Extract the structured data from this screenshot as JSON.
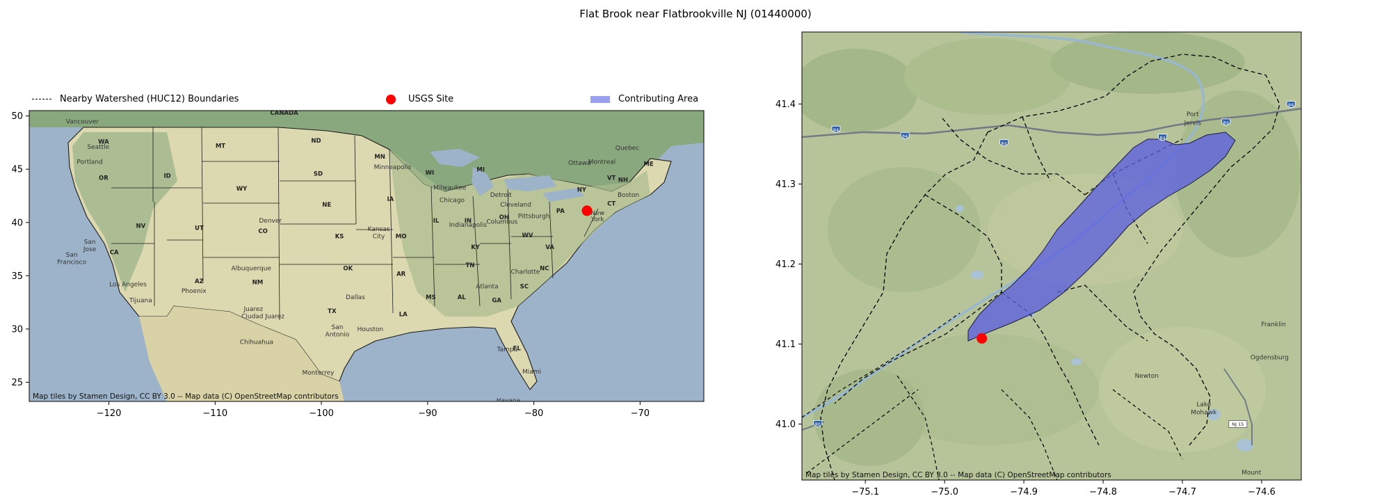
{
  "figure": {
    "title": "Flat Brook near Flatbrookville NJ (01440000)"
  },
  "legend": {
    "items": [
      {
        "key": "huc12",
        "label": "Nearby Watershed (HUC12) Boundaries",
        "style": "dashed-line"
      },
      {
        "key": "site",
        "label": "USGS Site",
        "style": "marker",
        "color": "#ff0000"
      },
      {
        "key": "area",
        "label": "Contributing Area",
        "style": "patch",
        "color": "#9aa0ee"
      }
    ]
  },
  "overview_map": {
    "extent": {
      "lon": [
        -127.5,
        -64.0
      ],
      "lat": [
        23.2,
        50.5
      ]
    },
    "x_ticks": [
      -120,
      -110,
      -100,
      -90,
      -80,
      -70
    ],
    "y_ticks": [
      25,
      30,
      35,
      40,
      45,
      50
    ],
    "site": {
      "lon": -75.0,
      "lat": 41.1
    },
    "credit": "Map tiles by Stamen Design, CC BY 3.0 -- Map data (C) OpenStreetMap contributors",
    "labels": [
      {
        "text": "CANADA",
        "lon": -103.5,
        "lat": 50.1
      },
      {
        "text": "Vancouver",
        "lon": -122.5,
        "lat": 49.3
      },
      {
        "text": "WA",
        "lon": -120.5,
        "lat": 47.4
      },
      {
        "text": "Seattle",
        "lon": -121.0,
        "lat": 46.9
      },
      {
        "text": "Portland",
        "lon": -121.8,
        "lat": 45.5
      },
      {
        "text": "OR",
        "lon": -120.5,
        "lat": 44.0
      },
      {
        "text": "ID",
        "lon": -114.5,
        "lat": 44.2
      },
      {
        "text": "MT",
        "lon": -109.5,
        "lat": 47.0
      },
      {
        "text": "WY",
        "lon": -107.5,
        "lat": 43.0
      },
      {
        "text": "NV",
        "lon": -117.0,
        "lat": 39.5
      },
      {
        "text": "UT",
        "lon": -111.5,
        "lat": 39.3
      },
      {
        "text": "CO",
        "lon": -105.5,
        "lat": 39.0
      },
      {
        "text": "Denver",
        "lon": -104.8,
        "lat": 40.0
      },
      {
        "text": "San",
        "lon": -121.8,
        "lat": 38.0
      },
      {
        "text": "Jose",
        "lon": -121.8,
        "lat": 37.3
      },
      {
        "text": "San",
        "lon": -123.5,
        "lat": 36.8
      },
      {
        "text": "Francisco",
        "lon": -123.5,
        "lat": 36.1
      },
      {
        "text": "CA",
        "lon": -119.5,
        "lat": 37.0
      },
      {
        "text": "Los Angeles",
        "lon": -118.2,
        "lat": 34.0
      },
      {
        "text": "AZ",
        "lon": -111.5,
        "lat": 34.3
      },
      {
        "text": "Phoenix",
        "lon": -112.0,
        "lat": 33.4
      },
      {
        "text": "Tijuana",
        "lon": -117.0,
        "lat": 32.5
      },
      {
        "text": "NM",
        "lon": -106.0,
        "lat": 34.2
      },
      {
        "text": "Albuquerque",
        "lon": -106.6,
        "lat": 35.5
      },
      {
        "text": "Juarez",
        "lon": -106.4,
        "lat": 31.7
      },
      {
        "text": "ND",
        "lon": -100.5,
        "lat": 47.5
      },
      {
        "text": "SD",
        "lon": -100.3,
        "lat": 44.4
      },
      {
        "text": "NE",
        "lon": -99.5,
        "lat": 41.5
      },
      {
        "text": "KS",
        "lon": -98.3,
        "lat": 38.5
      },
      {
        "text": "OK",
        "lon": -97.5,
        "lat": 35.5
      },
      {
        "text": "TX",
        "lon": -99.0,
        "lat": 31.5
      },
      {
        "text": "Dallas",
        "lon": -96.8,
        "lat": 32.8
      },
      {
        "text": "San",
        "lon": -98.5,
        "lat": 30.0
      },
      {
        "text": "Antonio",
        "lon": -98.5,
        "lat": 29.3
      },
      {
        "text": "Houston",
        "lon": -95.4,
        "lat": 29.8
      },
      {
        "text": "Ciudad Juarez",
        "lon": -105.5,
        "lat": 31.0
      },
      {
        "text": "Chihuahua",
        "lon": -106.1,
        "lat": 28.6
      },
      {
        "text": "Monterrey",
        "lon": -100.3,
        "lat": 25.7
      },
      {
        "text": "MN",
        "lon": -94.5,
        "lat": 46.0
      },
      {
        "text": "Minneapolis",
        "lon": -93.3,
        "lat": 45.0
      },
      {
        "text": "IA",
        "lon": -93.5,
        "lat": 42.0
      },
      {
        "text": "MO",
        "lon": -92.5,
        "lat": 38.5
      },
      {
        "text": "Kansas",
        "lon": -94.6,
        "lat": 39.2
      },
      {
        "text": "City",
        "lon": -94.6,
        "lat": 38.5
      },
      {
        "text": "AR",
        "lon": -92.5,
        "lat": 35.0
      },
      {
        "text": "LA",
        "lon": -92.3,
        "lat": 31.2
      },
      {
        "text": "WI",
        "lon": -89.8,
        "lat": 44.5
      },
      {
        "text": "Milwaukee",
        "lon": -87.9,
        "lat": 43.1
      },
      {
        "text": "Chicago",
        "lon": -87.7,
        "lat": 41.9
      },
      {
        "text": "IL",
        "lon": -89.2,
        "lat": 40.0
      },
      {
        "text": "MI",
        "lon": -85.0,
        "lat": 44.8
      },
      {
        "text": "Detroit",
        "lon": -83.1,
        "lat": 42.4
      },
      {
        "text": "IN",
        "lon": -86.2,
        "lat": 40.0
      },
      {
        "text": "Indianapolis",
        "lon": -86.2,
        "lat": 39.6
      },
      {
        "text": "OH",
        "lon": -82.8,
        "lat": 40.3
      },
      {
        "text": "Columbus",
        "lon": -83.0,
        "lat": 39.9
      },
      {
        "text": "Cleveland",
        "lon": -81.7,
        "lat": 41.5
      },
      {
        "text": "KY",
        "lon": -85.5,
        "lat": 37.5
      },
      {
        "text": "TN",
        "lon": -86.0,
        "lat": 35.8
      },
      {
        "text": "MS",
        "lon": -89.7,
        "lat": 32.8
      },
      {
        "text": "AL",
        "lon": -86.8,
        "lat": 32.8
      },
      {
        "text": "GA",
        "lon": -83.5,
        "lat": 32.5
      },
      {
        "text": "Atlanta",
        "lon": -84.4,
        "lat": 33.8
      },
      {
        "text": "FL",
        "lon": -81.6,
        "lat": 28.0
      },
      {
        "text": "Tampa",
        "lon": -82.5,
        "lat": 27.9
      },
      {
        "text": "Miami",
        "lon": -80.2,
        "lat": 25.8
      },
      {
        "text": "Havana",
        "lon": -82.4,
        "lat": 23.1
      },
      {
        "text": "SC",
        "lon": -80.9,
        "lat": 33.8
      },
      {
        "text": "NC",
        "lon": -79.0,
        "lat": 35.5
      },
      {
        "text": "Charlotte",
        "lon": -80.8,
        "lat": 35.2
      },
      {
        "text": "VA",
        "lon": -78.5,
        "lat": 37.5
      },
      {
        "text": "WV",
        "lon": -80.6,
        "lat": 38.6
      },
      {
        "text": "PA",
        "lon": -77.5,
        "lat": 40.9
      },
      {
        "text": "Pittsburgh",
        "lon": -80.0,
        "lat": 40.4
      },
      {
        "text": "NY",
        "lon": -75.5,
        "lat": 42.9
      },
      {
        "text": "New",
        "lon": -74.0,
        "lat": 40.7
      },
      {
        "text": "York",
        "lon": -74.0,
        "lat": 40.1
      },
      {
        "text": "Ottawa",
        "lon": -75.7,
        "lat": 45.4
      },
      {
        "text": "Montreal",
        "lon": -73.6,
        "lat": 45.5
      },
      {
        "text": "Quebec",
        "lon": -71.2,
        "lat": 46.8
      },
      {
        "text": "VT",
        "lon": -72.7,
        "lat": 44.0
      },
      {
        "text": "NH",
        "lon": -71.6,
        "lat": 43.8
      },
      {
        "text": "ME",
        "lon": -69.2,
        "lat": 45.3
      },
      {
        "text": "Boston",
        "lon": -71.1,
        "lat": 42.4
      },
      {
        "text": "CT",
        "lon": -72.7,
        "lat": 41.6
      }
    ]
  },
  "detail_map": {
    "extent": {
      "lon": [
        -75.18,
        -74.55
      ],
      "lat": [
        40.93,
        41.49
      ]
    },
    "x_ticks": [
      -75.1,
      -75.0,
      -74.9,
      -74.8,
      -74.7,
      -74.6
    ],
    "y_ticks": [
      41.0,
      41.1,
      41.2,
      41.3,
      41.4
    ],
    "site": {
      "lon": -74.953,
      "lat": 41.107
    },
    "credit": "Map tiles by Stamen Design, CC BY 3.0 -- Map data (C) OpenStreetMap contributors",
    "labels": [
      {
        "text": "Port",
        "lon": -74.687,
        "lat": 41.385
      },
      {
        "text": "Jervis",
        "lon": -74.687,
        "lat": 41.374
      },
      {
        "text": "Franklin",
        "lon": -74.585,
        "lat": 41.122
      },
      {
        "text": "Ogdensburg",
        "lon": -74.59,
        "lat": 41.081
      },
      {
        "text": "Newton",
        "lon": -74.745,
        "lat": 41.058
      },
      {
        "text": "Lake",
        "lon": -74.673,
        "lat": 41.022
      },
      {
        "text": "Mohawk",
        "lon": -74.673,
        "lat": 41.012
      },
      {
        "text": "Mount",
        "lon": -74.613,
        "lat": 40.937
      }
    ],
    "road_shields": [
      {
        "text": "84",
        "lon": -75.137,
        "lat": 41.368
      },
      {
        "text": "84",
        "lon": -75.05,
        "lat": 41.36
      },
      {
        "text": "84",
        "lon": -74.925,
        "lat": 41.351
      },
      {
        "text": "84",
        "lon": -74.725,
        "lat": 41.358
      },
      {
        "text": "84",
        "lon": -74.645,
        "lat": 41.377
      },
      {
        "text": "84",
        "lon": -74.563,
        "lat": 41.399
      },
      {
        "text": "80",
        "lon": -75.16,
        "lat": 41.0
      },
      {
        "text": "NJ 15",
        "lon": -74.63,
        "lat": 41.0
      }
    ]
  }
}
